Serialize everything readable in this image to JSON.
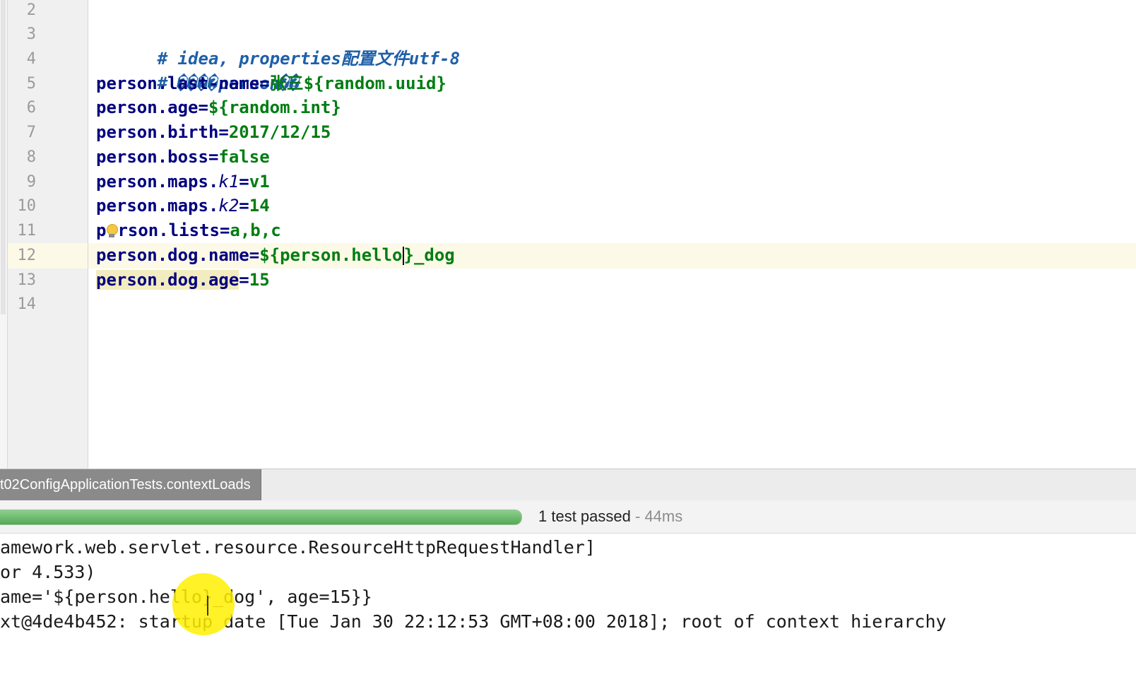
{
  "editor": {
    "lines": [
      {
        "number": "2"
      },
      {
        "number": "3",
        "comment": "# idea, properties配置文件utf-8"
      },
      {
        "number": "4",
        "comment": "# ����person�� "
      },
      {
        "number": "5",
        "key": "person.last-name",
        "eq": "=",
        "value": "张三${random.uuid}"
      },
      {
        "number": "6",
        "key": "person.age",
        "eq": "=",
        "value": "${random.int}"
      },
      {
        "number": "7",
        "key": "person.birth",
        "eq": "=",
        "value": "2017/12/15"
      },
      {
        "number": "8",
        "key": "person.boss",
        "eq": "=",
        "value": "false"
      },
      {
        "number": "9",
        "key_prefix": "person.maps.",
        "key_italic": "k1",
        "eq": "=",
        "value": "v1"
      },
      {
        "number": "10",
        "key_prefix": "person.maps.",
        "key_italic": "k2",
        "eq": "=",
        "value": "14"
      },
      {
        "number": "11",
        "key_a": "p",
        "key_b": "rson.lists",
        "eq": "=",
        "value": "a,b,c"
      },
      {
        "number": "12",
        "key": "person.dog.name",
        "eq": "=",
        "value_a": "${person.hello",
        "value_b": "}_dog"
      },
      {
        "number": "13",
        "key": "person.dog.age",
        "eq": "=",
        "value": "15"
      },
      {
        "number": "14"
      }
    ]
  },
  "tool_window": {
    "active_tab": "t02ConfigApplicationTests.contextLoads",
    "progress": {
      "fraction": 1.0,
      "color": "#5cb85c"
    },
    "status_text": "1 test passed",
    "status_sep": " - ",
    "status_duration": "44ms"
  },
  "console": {
    "lines": [
      "amework.web.servlet.resource.ResourceHttpRequestHandler]",
      "or 4.533)",
      "ame='${person.hello}_dog', age=15}}",
      "xt@4de4b452: startup date [Tue Jan 30 22:12:53 GMT+08:00 2018]; root of context hierarchy"
    ]
  }
}
